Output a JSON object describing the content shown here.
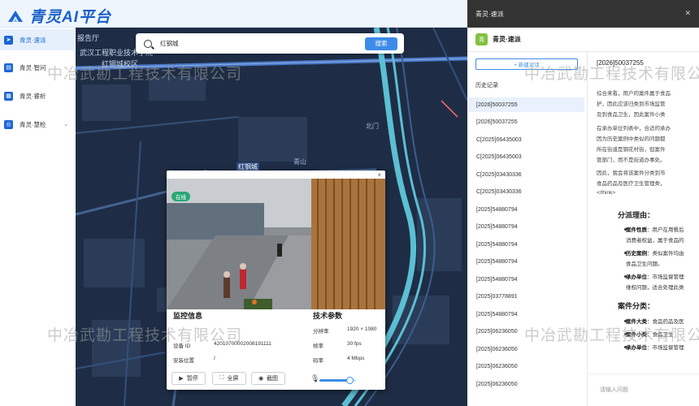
{
  "app": {
    "title": "青灵AI平台"
  },
  "sidebar": {
    "items": [
      {
        "label": "青灵·速派",
        "icon": "send-icon",
        "active": true
      },
      {
        "label": "青灵·智问",
        "icon": "chat-icon"
      },
      {
        "label": "青灵·睿析",
        "icon": "analysis-icon"
      },
      {
        "label": "青灵·慧检",
        "icon": "inspect-icon",
        "expandable": true
      }
    ]
  },
  "search": {
    "value": "红钢城",
    "button": "搜索"
  },
  "map": {
    "labels": [
      "报告厅",
      "武汉工程职业技术学院",
      "红钢城校区",
      "北门",
      "红钢城",
      "青山"
    ]
  },
  "monitor": {
    "badge": "在线",
    "close": "×",
    "info_title": "监控信息",
    "fields": [
      {
        "label": "设备 ID",
        "value": "42010700002008191111"
      },
      {
        "label": "安装位置",
        "value": "/"
      }
    ],
    "tech_title": "技术参数",
    "tech": [
      {
        "label": "分辨率",
        "value": "1920 × 1080"
      },
      {
        "label": "帧率",
        "value": "30 fps"
      },
      {
        "label": "码率",
        "value": "4 Mbps"
      }
    ],
    "controls": {
      "pause": "暂停",
      "fullscreen": "全屏",
      "screenshot": "截图"
    },
    "volume": 0.85
  },
  "panel": {
    "window_title": "青灵·速派",
    "header_title": "青灵·速派",
    "new_chat": "+ 新建对话",
    "history_title": "历史记录",
    "history": [
      "[2026]50037255",
      "[2026]50037255",
      "C[2025]06435003",
      "C[2025]06435003",
      "C[2025]03430336",
      "C[2025]03430336",
      "[2025]54880794",
      "[2025]54880794",
      "[2025]54880794",
      "[2025]54880794",
      "[2025]54880794",
      "[2025]03778891",
      "[2025]54880794",
      "[2025]06236050",
      "[2025]06236050",
      "[2025]06236050",
      "[2025]06236050"
    ],
    "chat": {
      "case_id": "[2026]50037255",
      "lines": [
        "综合来看，用户的案件属于食品",
        "护，因此应该归类到市场监管",
        "及到食品卫生，因此案件小类",
        "在承办单位列表中，合适的承办",
        "因为历史案例中类似的问题都",
        "所在街道是钢花村街，但案件",
        "管部门，而不是街道办事处。",
        "因此，我会将该案件分类到市",
        "食品药品及医疗卫生管理类，",
        "</think>"
      ],
      "section1": "分派理由：",
      "reasons": [
        {
          "k": "案件性质",
          "v": "：用户在用餐后"
        },
        {
          "k": "",
          "v": "消费者权益，属于食品的"
        },
        {
          "k": "历史案例",
          "v": "：类似案件均由"
        },
        {
          "k": "",
          "v": "食品卫生问题。"
        },
        {
          "k": "承办单位",
          "v": "：市场监督管理"
        },
        {
          "k": "",
          "v": "维权问题，适合处理此类"
        }
      ],
      "section2": "案件分类：",
      "categories": [
        {
          "k": "案件大类",
          "v": "：食品药品及医"
        },
        {
          "k": "案件小类",
          "v": "：食品卫生"
        },
        {
          "k": "承办单位",
          "v": "：市场监督管理"
        }
      ],
      "input_placeholder": "请输入问题"
    }
  },
  "watermark": "中冶武勘工程技术有限公司"
}
